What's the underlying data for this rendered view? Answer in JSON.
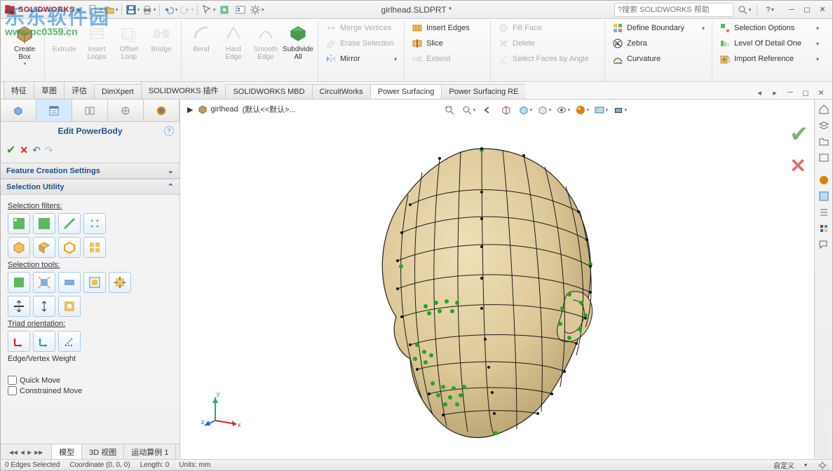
{
  "app": {
    "product": "SOLIDWORKS",
    "watermark_main": "乐东软件园",
    "watermark_url": "www.pc0359.cn"
  },
  "document": {
    "title": "girlhead.SLDPRT *"
  },
  "search": {
    "placeholder": "搜索 SOLIDWORKS 帮助"
  },
  "ribbon": {
    "big": {
      "create_box": "Create\nBox",
      "extrude": "Extrude",
      "insert_loops": "Insert\nLoops",
      "offset_loop": "Offset\nLoop",
      "bridge": "Bridge",
      "bend": "Bend",
      "hard_edge": "Hard\nEdge",
      "smooth_edge": "Smooth\nEdge",
      "subdivide_all": "Subdivide\nAll"
    },
    "cmd": {
      "merge_vertices": "Merge Vertices",
      "erase_selection": "Erase Selection",
      "mirror": "Mirror",
      "insert_edges": "Insert Edges",
      "slice": "Slice",
      "extend": "Extend",
      "fill_face": "Fill Face",
      "delete": "Delete",
      "select_faces_by_angle": "Select Faces by Angle",
      "define_boundary": "Define Boundary",
      "zebra": "Zebra",
      "curvature": "Curvature",
      "selection_options": "Selection Options",
      "level_of_detail_one": "Level Of Detail One",
      "import_reference": "Import Reference"
    }
  },
  "tabs": [
    "特征",
    "草图",
    "评估",
    "DimXpert",
    "SOLIDWORKS 插件",
    "SOLIDWORKS MBD",
    "CircuitWorks",
    "Power Surfacing",
    "Power Surfacing RE"
  ],
  "active_tab": "Power Surfacing",
  "breadcrumb": {
    "part": "girlhead",
    "config": "(默认<<默认>..."
  },
  "left_panel": {
    "title": "Edit PowerBody",
    "sections": {
      "feature_creation": "Feature Creation Settings",
      "selection_utility": "Selection Utility"
    },
    "labels": {
      "selection_filters": "Selection filters:",
      "selection_tools": "Selection tools:",
      "triad_orientation": "Triad orientation:",
      "edge_vertex_weight": "Edge/Vertex Weight"
    },
    "checks": {
      "quick_move": "Quick Move",
      "constrained_move": "Constrained Move"
    }
  },
  "view_tabs": [
    "模型",
    "3D 视图",
    "运动算例 1"
  ],
  "status": {
    "selection": "0 Edges Selected",
    "coord": "Coordinate (0, 0, 0)",
    "length": "Length: 0",
    "units": "Units: mm",
    "custom": "自定义"
  }
}
